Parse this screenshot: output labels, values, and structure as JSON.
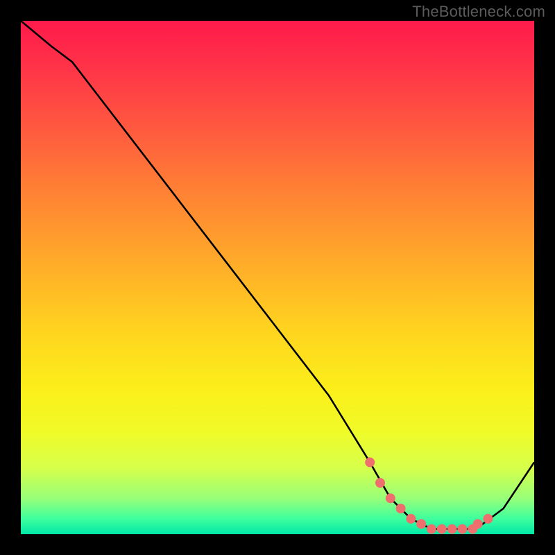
{
  "watermark": "TheBottleneck.com",
  "chart_data": {
    "type": "line",
    "title": "",
    "xlabel": "",
    "ylabel": "",
    "xlim": [
      0,
      100
    ],
    "ylim": [
      0,
      100
    ],
    "series": [
      {
        "name": "bottleneck-curve",
        "x": [
          0,
          6,
          10,
          20,
          30,
          40,
          50,
          60,
          68,
          72,
          76,
          80,
          84,
          88,
          90,
          94,
          100
        ],
        "y": [
          100,
          95,
          92,
          79,
          66,
          53,
          40,
          27,
          14,
          7,
          3,
          1,
          1,
          1,
          2,
          5,
          14
        ]
      }
    ],
    "valley_markers": {
      "name": "valley-dots",
      "x": [
        68,
        70,
        72,
        74,
        76,
        78,
        80,
        82,
        84,
        86,
        88,
        89,
        91
      ],
      "y": [
        14,
        10,
        7,
        5,
        3,
        2,
        1,
        1,
        1,
        1,
        1,
        2,
        3
      ]
    },
    "colors": {
      "curve": "#000000",
      "markers": "#ef6e6e",
      "gradient_top": "#ff1a4b",
      "gradient_bottom": "#00e8a8"
    }
  }
}
